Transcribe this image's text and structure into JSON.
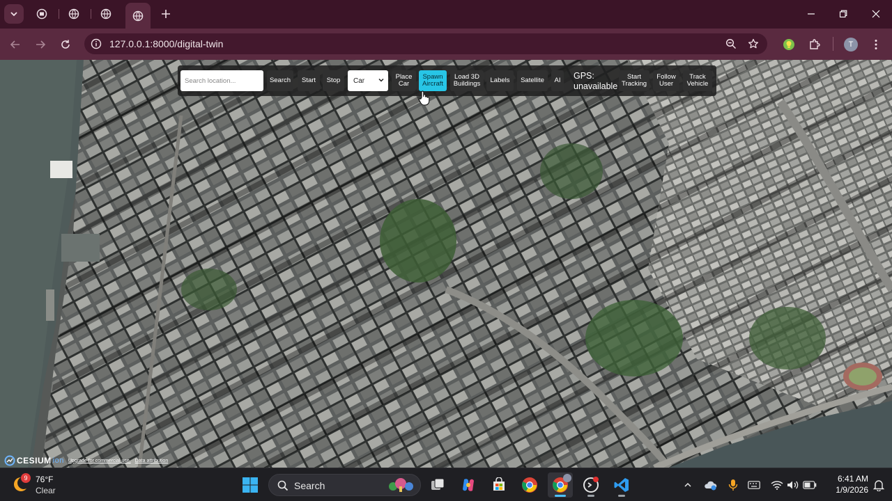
{
  "browser": {
    "tabs": [
      {
        "icon": "shield-favicon-icon"
      },
      {
        "icon": "globe-favicon-icon"
      },
      {
        "icon": "globe-favicon-icon"
      },
      {
        "icon": "globe-favicon-icon",
        "active": true
      }
    ],
    "url": "127.0.0.1:8000/digital-twin",
    "profile_initial": "T",
    "colors": {
      "frame": "#3b1427",
      "toolbar": "#5a2a40",
      "omnibox": "#43182d"
    }
  },
  "app": {
    "search_placeholder": "Search location...",
    "buttons": {
      "search": "Search",
      "start": "Start",
      "stop": "Stop",
      "place_car": "Place\nCar",
      "spawn_aircraft": "Spawn\nAircraft",
      "load_buildings": "Load 3D\nBuildings",
      "labels": "Labels",
      "satellite": "Satellite",
      "ai": "AI",
      "start_tracking": "Start\nTracking",
      "follow_user": "Follow\nUser",
      "track_vehicle": "Track\nVehicle"
    },
    "vehicle_select": {
      "selected": "Car"
    },
    "gps_status": "GPS:\nunavailable",
    "active_button": "spawn_aircraft",
    "accent_color": "#27c5e6"
  },
  "cesium": {
    "logo_text": "CESIUM",
    "logo_suffix": "ion",
    "upgrade_link": "Upgrade for commercial use.",
    "attribution_link": "Data attribution"
  },
  "taskbar": {
    "weather": {
      "temp": "76°F",
      "desc": "Clear",
      "badge": "9"
    },
    "search_label": "Search",
    "clock": {
      "time": "6:41 AM",
      "date": "1/9/2026"
    }
  }
}
